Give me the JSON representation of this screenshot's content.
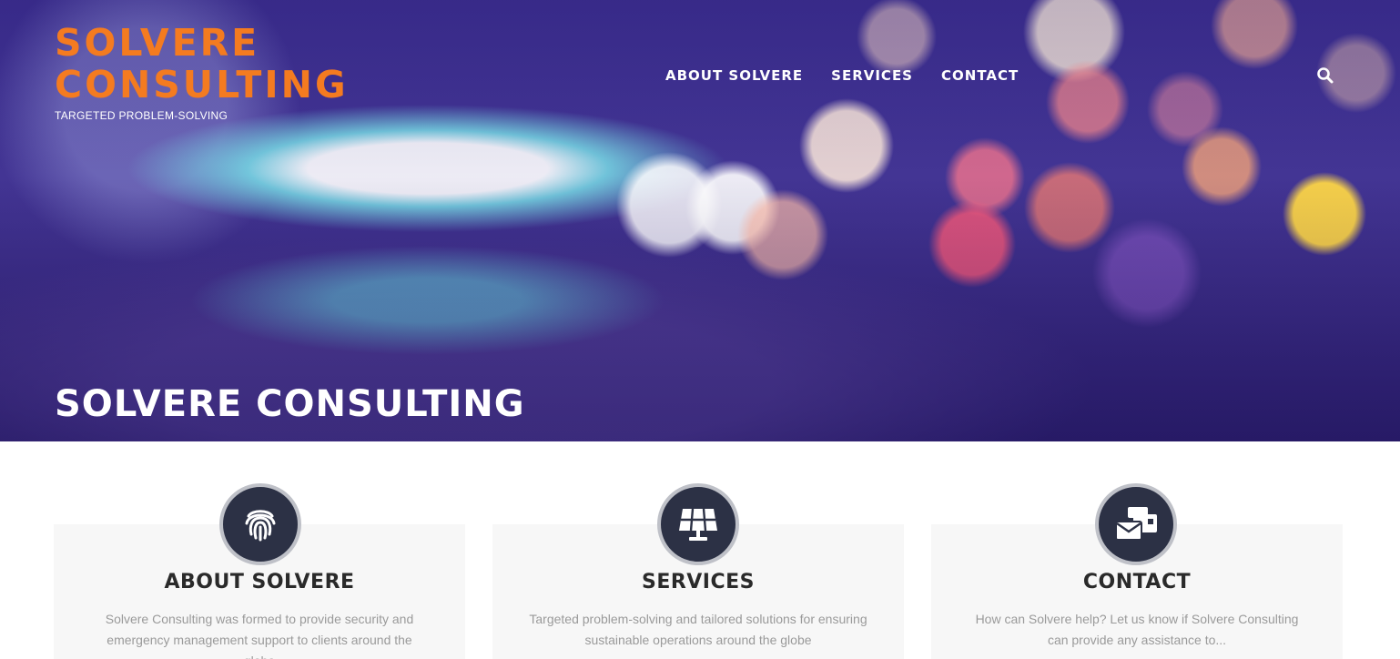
{
  "brand": {
    "name_line1": "SOLVERE",
    "name_line2": "CONSULTING",
    "tagline": "TARGETED PROBLEM-SOLVING",
    "accent_color": "#f47b20"
  },
  "nav": {
    "items": [
      {
        "label": "ABOUT SOLVERE"
      },
      {
        "label": "SERVICES"
      },
      {
        "label": "CONTACT"
      }
    ],
    "search_icon": "search-icon"
  },
  "hero": {
    "title": "SOLVERE CONSULTING"
  },
  "cards": [
    {
      "icon": "fingerprint-icon",
      "title": "ABOUT SOLVERE",
      "description": "Solvere Consulting was formed to provide security and emergency management support to clients around the globe"
    },
    {
      "icon": "solar-panel-icon",
      "title": "SERVICES",
      "description": "Targeted problem-solving and tailored solutions for ensuring sustainable operations around the globe"
    },
    {
      "icon": "mail-bulk-icon",
      "title": "CONTACT",
      "description": "How can Solvere help? Let us know if Solvere Consulting can provide any assistance to..."
    }
  ],
  "colors": {
    "icon_circle": "#2c3145",
    "card_background": "#f7f7f7"
  }
}
